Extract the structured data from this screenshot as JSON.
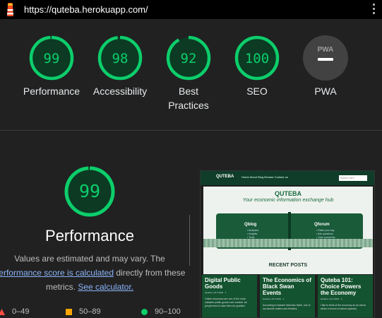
{
  "topbar": {
    "url": "https://quteba.herokuapp.com/"
  },
  "scores": [
    {
      "value": "99",
      "label": "Performance",
      "fraction": 0.99
    },
    {
      "value": "98",
      "label": "Accessibility",
      "fraction": 0.98
    },
    {
      "value": "92",
      "label": "Best Practices",
      "fraction": 0.92
    },
    {
      "value": "100",
      "label": "SEO",
      "fraction": 1.0
    },
    {
      "value": "",
      "label": "PWA",
      "badge": "PWA"
    }
  ],
  "performance": {
    "score": "99",
    "fraction": 0.99,
    "title": "Performance",
    "desc_line1": "Values are estimated and may vary. The",
    "desc_link1": "performance score is calculated",
    "desc_mid": "directly from these",
    "desc_line3": "metrics.",
    "desc_link2": "See calculator."
  },
  "legend": {
    "fail": "0–49",
    "average": "50–89",
    "pass": "90–100"
  },
  "colors": {
    "pass": "#0cce6b",
    "average": "#ffa400",
    "fail": "#ff4e42",
    "background": "#212121"
  },
  "screenshot": {
    "brand": "QUTEBA",
    "nav": "Home   About   Blog   Browse   Contact us",
    "search": "Search Here",
    "hero_title": "QUTEBA",
    "hero_sub": "Your economic information exchange hub",
    "left_page": "Qblog",
    "left_items": [
      "• Analyses",
      "• Insights",
      "• Tools"
    ],
    "right_page": "Qforum",
    "right_items": [
      "• Raise your say",
      "• Ask questions",
      "• Give comments"
    ],
    "recent": "RECENT POSTS",
    "cards": [
      {
        "title": "Digital Public Goods",
        "meta": "Quteba | Jul 6 2022 · 1",
        "text": "Online resources are one of the most valuable public goods ever created. As people tend to take them for granted,"
      },
      {
        "title": "The Economics of Black Swan Events",
        "meta": "Quteba | Jul 6 2022 · 1",
        "text": "According to Nassim Nicholas Taleb, one of my favorite writers and thinkers,"
      },
      {
        "title": "Quteba 101: Choice Powers the Economy",
        "meta": "Quteba | Jul 6 2022 · 1",
        "text": "I like to think of the economy as an arena where a bunch of actors (quests)"
      }
    ]
  }
}
